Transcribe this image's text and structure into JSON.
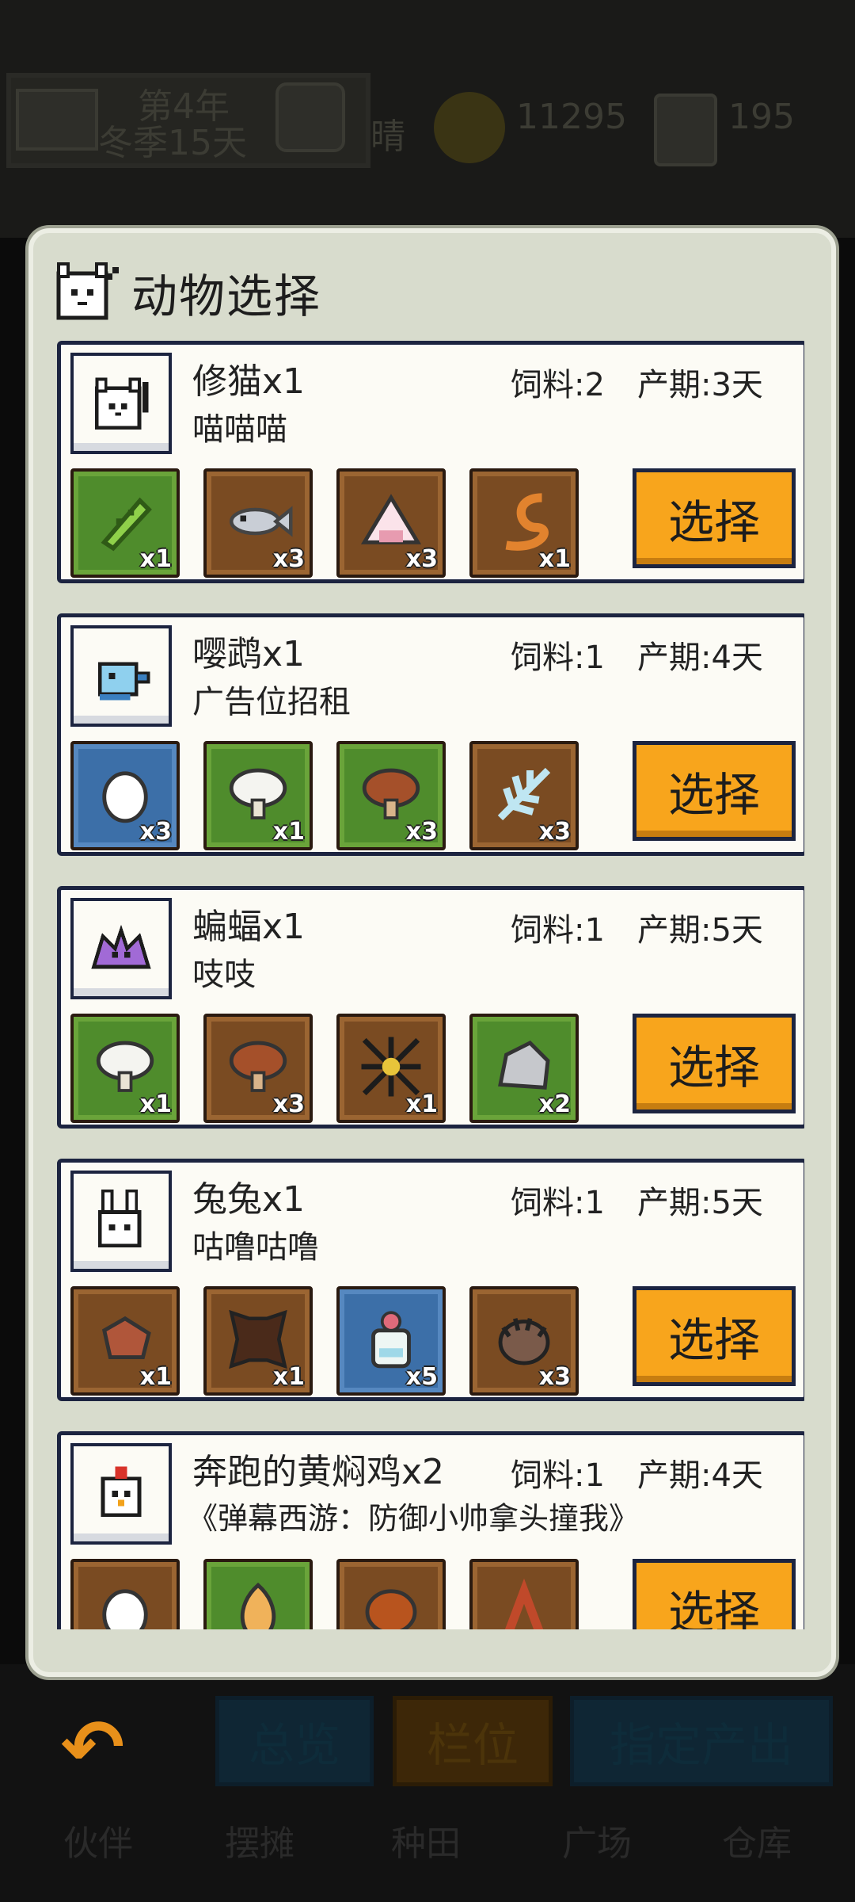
{
  "background": {
    "year": "第4年",
    "season_day": "冬季15天",
    "weather": "晴",
    "coins": "11295",
    "tickets": "195",
    "tabs": [
      "总览",
      "栏位",
      "指定产出"
    ],
    "nav": [
      "伙伴",
      "摆摊",
      "种田",
      "广场",
      "仓库"
    ]
  },
  "panel": {
    "title": "动物选择",
    "animals": [
      {
        "name": "修猫x1",
        "desc": "喵喵喵",
        "feed": "饲料:2",
        "period": "产期:3天",
        "portrait_icon": "cat-icon",
        "items": [
          {
            "icon": "cucumber-icon",
            "bg": "green",
            "qty": "x1"
          },
          {
            "icon": "fish-icon",
            "bg": "brown",
            "qty": "x3"
          },
          {
            "icon": "rice-ball-icon",
            "bg": "brown",
            "qty": "x3"
          },
          {
            "icon": "shrimp-icon",
            "bg": "brown",
            "qty": "x1"
          }
        ],
        "button": "选择"
      },
      {
        "name": "嘤鹉x1",
        "desc": "广告位招租",
        "feed": "饲料:1",
        "period": "产期:4天",
        "portrait_icon": "parrot-icon",
        "items": [
          {
            "icon": "egg-icon",
            "bg": "blue",
            "qty": "x3"
          },
          {
            "icon": "white-mushroom-icon",
            "bg": "green",
            "qty": "x1"
          },
          {
            "icon": "brown-mushroom-icon",
            "bg": "green",
            "qty": "x3"
          },
          {
            "icon": "feather-icon",
            "bg": "brown",
            "qty": "x3"
          }
        ],
        "button": "选择"
      },
      {
        "name": "蝙蝠x1",
        "desc": "吱吱",
        "feed": "饲料:1",
        "period": "产期:5天",
        "portrait_icon": "bat-icon",
        "items": [
          {
            "icon": "white-mushroom-icon",
            "bg": "green",
            "qty": "x1"
          },
          {
            "icon": "brown-mushroom-icon",
            "bg": "brown",
            "qty": "x3"
          },
          {
            "icon": "web-icon",
            "bg": "brown",
            "qty": "x1"
          },
          {
            "icon": "stone-icon",
            "bg": "green",
            "qty": "x2"
          }
        ],
        "button": "选择"
      },
      {
        "name": "兔兔x1",
        "desc": "咕噜咕噜",
        "feed": "饲料:1",
        "period": "产期:5天",
        "portrait_icon": "rabbit-icon",
        "items": [
          {
            "icon": "meat-icon",
            "bg": "brown",
            "qty": "x1"
          },
          {
            "icon": "leather-icon",
            "bg": "brown",
            "qty": "x1"
          },
          {
            "icon": "potion-icon",
            "bg": "blue",
            "qty": "x5"
          },
          {
            "icon": "hedgehog-icon",
            "bg": "brown",
            "qty": "x3"
          }
        ],
        "button": "选择"
      },
      {
        "name": "奔跑的黄焖鸡x2",
        "desc": "《弹幕西游：防御小帅拿头撞我》",
        "feed": "饲料:1",
        "period": "产期:4天",
        "portrait_icon": "chicken-icon",
        "items": [
          {
            "icon": "egg-icon",
            "bg": "brown",
            "qty": ""
          },
          {
            "icon": "leaf-icon",
            "bg": "green",
            "qty": ""
          },
          {
            "icon": "drumstick-icon",
            "bg": "brown",
            "qty": ""
          },
          {
            "icon": "wood-icon",
            "bg": "brown",
            "qty": ""
          }
        ],
        "button": "选择"
      }
    ]
  }
}
